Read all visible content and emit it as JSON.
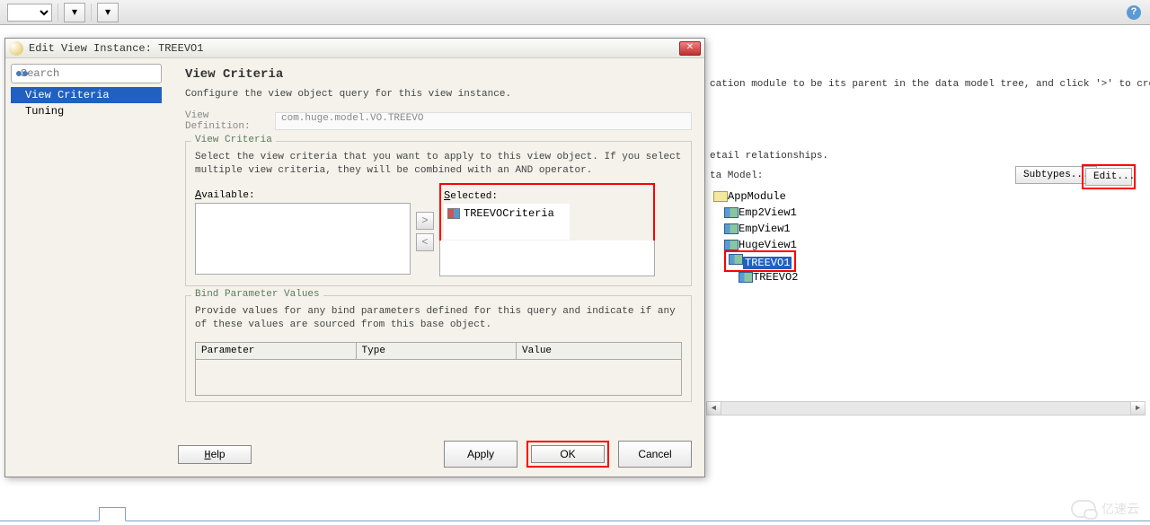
{
  "toolbar": {
    "dropdown_icon": "▾"
  },
  "help_icon": "?",
  "background": {
    "text1": "cation module to be its parent in the data model tree, and click '>' to create",
    "text2": "etail relationships.",
    "data_model_label": "ta Model:",
    "subtypes_btn": "Subtypes...",
    "edit_btn": "Edit...",
    "tree": {
      "root": "AppModule",
      "items": [
        "Emp2View1",
        "EmpView1",
        "HugeView1",
        "TREEVO1"
      ],
      "child": "TREEVO2"
    }
  },
  "dialog": {
    "title": "Edit View Instance: TREEVO1",
    "sidebar": {
      "search_placeholder": "Search",
      "items": [
        "View Criteria",
        "Tuning"
      ],
      "selected_index": 0
    },
    "content": {
      "heading": "View Criteria",
      "subtitle": "Configure the view object query for this view instance.",
      "view_def_label": "View Definition:",
      "view_def_value": "com.huge.model.VO.TREEVO",
      "vc_fieldset": {
        "legend": "View Criteria",
        "text": "Select the view criteria that you want to apply to this view object. If you select multiple view criteria, they will be combined with an AND operator.",
        "available_label": "Available:",
        "selected_label": "Selected:",
        "selected_items": [
          "TREEVOCriteria"
        ]
      },
      "bind_fieldset": {
        "legend": "Bind Parameter Values",
        "text": "Provide values for any bind parameters defined for this query and indicate if any of these values are sourced from this base object.",
        "cols": [
          "Parameter",
          "Type",
          "Value"
        ]
      }
    },
    "buttons": {
      "help": "Help",
      "apply": "Apply",
      "ok": "OK",
      "cancel": "Cancel"
    }
  },
  "watermark": "亿速云"
}
